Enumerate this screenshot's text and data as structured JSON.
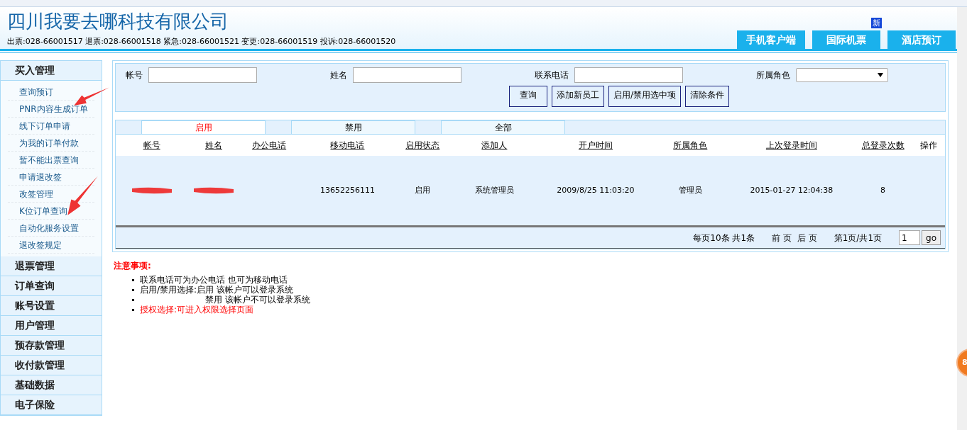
{
  "header": {
    "company": "四川我要去哪科技有限公司",
    "hotlines": "出票:028-66001517 退票:028-66001518 紧急:028-66001521 变更:028-66001519 投诉:028-66001520",
    "nav_buttons": [
      {
        "label": "手机客户端"
      },
      {
        "label": "国际机票",
        "badge": "新"
      },
      {
        "label": "酒店预订"
      }
    ]
  },
  "sidebar": {
    "sections": [
      {
        "label": "买入管理",
        "items": [
          "查询预订",
          "PNR内容生成订单",
          "线下订单申请",
          "为我的订单付款",
          "暂不能出票查询",
          "申请退改签",
          "改签管理",
          "K位订单查询",
          "自动化服务设置",
          "退改签规定"
        ]
      },
      {
        "label": "退票管理"
      },
      {
        "label": "订单查询"
      },
      {
        "label": "账号设置"
      },
      {
        "label": "用户管理"
      },
      {
        "label": "预存款管理"
      },
      {
        "label": "收付款管理"
      },
      {
        "label": "基础数据"
      },
      {
        "label": "电子保险"
      }
    ]
  },
  "search": {
    "fields": [
      {
        "label": "帐号",
        "kind": "text"
      },
      {
        "label": "姓名",
        "kind": "text"
      },
      {
        "label": "联系电话",
        "kind": "text"
      },
      {
        "label": "所属角色",
        "kind": "select"
      }
    ],
    "buttons": [
      "查询",
      "添加新员工",
      "启用/禁用选中项",
      "清除条件"
    ]
  },
  "tabs": [
    {
      "label": "启用",
      "selected": true
    },
    {
      "label": "禁用",
      "selected": false
    },
    {
      "label": "全部",
      "selected": false
    }
  ],
  "table": {
    "columns": [
      {
        "label": "帐号",
        "sortable": true
      },
      {
        "label": "姓名",
        "sortable": true
      },
      {
        "label": "办公电话",
        "sortable": true
      },
      {
        "label": "移动电话",
        "sortable": true
      },
      {
        "label": "启用状态",
        "sortable": true
      },
      {
        "label": "添加人",
        "sortable": true
      },
      {
        "label": "开户时间",
        "sortable": true
      },
      {
        "label": "所属角色",
        "sortable": true
      },
      {
        "label": "上次登录时间",
        "sortable": true
      },
      {
        "label": "总登录次数",
        "sortable": true
      },
      {
        "label": "操作",
        "sortable": false
      }
    ],
    "rows": [
      {
        "cells": [
          {
            "kind": "redacted"
          },
          {
            "kind": "redacted"
          },
          {
            "kind": "empty"
          },
          {
            "kind": "text",
            "text": "13652256111"
          },
          {
            "kind": "text",
            "text": "启用"
          },
          {
            "kind": "text",
            "text": "系统管理员"
          },
          {
            "kind": "text",
            "text": "2009/8/25 11:03:20"
          },
          {
            "kind": "text",
            "text": "管理员"
          },
          {
            "kind": "text",
            "text": "2015-01-27 12:04:38"
          },
          {
            "kind": "text",
            "text": "8"
          },
          {
            "kind": "empty"
          }
        ]
      }
    ]
  },
  "pager": {
    "summary": "每页10条 共1条",
    "prev": "前 页",
    "next": "后 页",
    "page_info": "第1页/共1页",
    "page_value": "1",
    "go": "go"
  },
  "notes": {
    "title": "注意事项:",
    "items": [
      {
        "text": "联系电话可为办公电话 也可为移动电话",
        "kind": "plain",
        "highlighted": false
      },
      {
        "text": "启用/禁用选择:启用 该帐户可以登录系统",
        "kind": "plain",
        "highlighted": false
      },
      {
        "text": "禁用 该帐户不可以登录系统",
        "kind": "indent",
        "highlighted": false
      },
      {
        "text": "授权选择:可进入权限选择页面",
        "kind": "plain",
        "highlighted": true
      }
    ]
  },
  "floating_badge": {
    "text": "8"
  }
}
